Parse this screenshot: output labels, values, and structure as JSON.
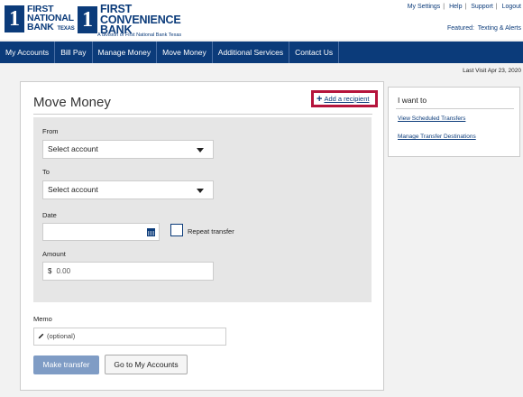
{
  "brand": {
    "logo1": {
      "mark": "1",
      "line1": "FIRST",
      "line2": "NATIONAL",
      "line3": "BANK",
      "suffix": "TEXAS"
    },
    "logo2": {
      "mark": "1",
      "line1": "FIRST",
      "line2": "CONVENIENCE",
      "line3": "BANK"
    },
    "division": "A division of First National Bank Texas",
    "color": "#0b3b7a"
  },
  "utility": {
    "links": [
      "My Settings",
      "Help",
      "Support",
      "Logout"
    ],
    "featured_prefix": "Featured:",
    "featured_link": "Texting & Alerts"
  },
  "nav": [
    "My Accounts",
    "Bill Pay",
    "Manage Money",
    "Move Money",
    "Additional Services",
    "Contact Us"
  ],
  "last_visit": "Last Visit Apr 23, 2020",
  "main": {
    "title": "Move Money",
    "add_recipient": "Add a recipient",
    "from_label": "From",
    "from_value": "Select account",
    "to_label": "To",
    "to_value": "Select account",
    "date_label": "Date",
    "date_value": "",
    "repeat_label": "Repeat transfer",
    "amount_label": "Amount",
    "amount_currency": "$",
    "amount_value": "0.00",
    "memo_label": "Memo",
    "memo_placeholder": "(optional)",
    "make_transfer": "Make transfer",
    "go_to_accounts": "Go to My Accounts",
    "highlight_color": "#b5143c"
  },
  "sidebar": {
    "title": "I want to",
    "links": [
      "View Scheduled Transfers",
      "Manage Transfer Destinations"
    ]
  }
}
